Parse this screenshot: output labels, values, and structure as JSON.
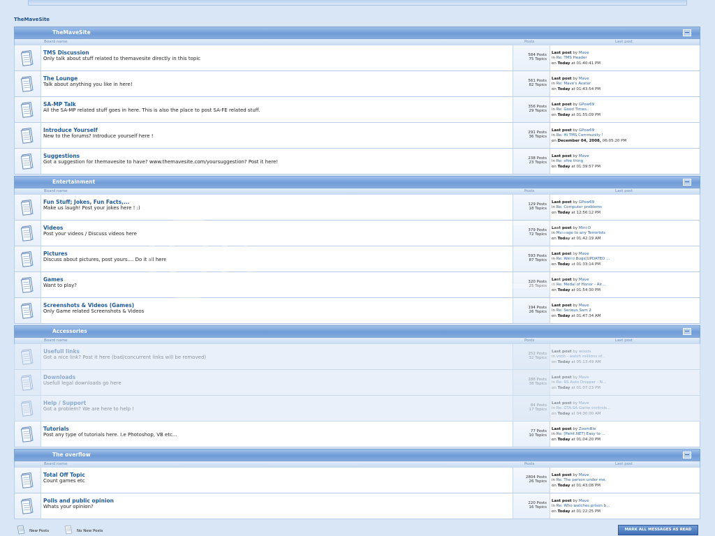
{
  "site": {
    "name": "TheMaveSite"
  },
  "columns": {
    "board_name": "Board name",
    "posts": "Posts",
    "last_post": "Last post"
  },
  "labels": {
    "last_post": "Last post",
    "by": "by",
    "in": "in",
    "on": "on"
  },
  "categories": [
    {
      "title": "TheMaveSite",
      "boards": [
        {
          "name": "TMS Discussion",
          "desc": "Only talk about stuff related to themavesite directly in this topic",
          "posts": "584 Posts",
          "topics": "75 Topics",
          "last_user": "Mave",
          "last_topic": "Re: TMS Header",
          "last_date": "Today",
          "last_time": "at 01:40:41 PM",
          "faded": false
        },
        {
          "name": "The Lounge",
          "desc": "Talk about anything you like in here!",
          "posts": "561 Posts",
          "topics": "82 Topics",
          "last_user": "Mave",
          "last_topic": "Re: Mave's Avatar",
          "last_date": "Today",
          "last_time": "at 01:43:54 PM",
          "faded": false
        },
        {
          "name": "SA-MP Talk",
          "desc": "All the SA-MP related stuff goes in here. This is also the place to post SA-FE related stuff.",
          "posts": "356 Posts",
          "topics": "29 Topics",
          "last_user": "GPow69",
          "last_topic": "Re: Good Times..",
          "last_date": "Today",
          "last_time": "at 01:55:09 PM",
          "faded": false
        },
        {
          "name": "Introduce Yourself",
          "desc": "New to the forums? Introduce yourself here !",
          "posts": "291 Posts",
          "topics": "36 Topics",
          "last_user": "GPow69",
          "last_topic": "Re: Hi TMS Community !",
          "last_date": "December 04, 2008,",
          "last_time": "06:05:20 PM",
          "faded": false
        },
        {
          "name": "Suggestions",
          "desc": "Got a suggestion for themavesite to have? www.themavesite.com/yoursuggestion? Post it here!",
          "posts": "238 Posts",
          "topics": "23 Topics",
          "last_user": "Mave",
          "last_topic": "Re: sfire thing",
          "last_date": "Today",
          "last_time": "at 01:39:57 PM",
          "faded": false
        }
      ]
    },
    {
      "title": "Entertainment",
      "boards": [
        {
          "name": "Fun Stuff; Jokes, Fun Facts,...",
          "desc": "Make us laugh! Post your jokes here ! :)",
          "posts": "129 Posts",
          "topics": "18 Topics",
          "last_user": "GPow69",
          "last_topic": "Re: Computer problems",
          "last_date": "Today",
          "last_time": "at 12:56:12 PM",
          "faded": false
        },
        {
          "name": "Videos",
          "desc": "Post your videos / Discuss videos here",
          "posts": "379 Posts",
          "topics": "72 Topics",
          "last_user": "Mini-D",
          "last_topic": "Message to any Terrorists",
          "last_date": "Today",
          "last_time": "at 01:42:19 AM",
          "faded": false
        },
        {
          "name": "Pictures",
          "desc": "Discuss about pictures, post yours.... Do it all here",
          "posts": "593 Posts",
          "topics": "87 Topics",
          "last_user": "Mave",
          "last_topic": "Re: Weird Bugs[UPDATED ...",
          "last_date": "Today",
          "last_time": "at 01:33:14 PM",
          "faded": false
        },
        {
          "name": "Games",
          "desc": "Want to play?",
          "posts": "320 Posts",
          "topics": "25 Topics",
          "last_user": "Mave",
          "last_topic": "Re: Medal of Honor - Air...",
          "last_date": "Today",
          "last_time": "at 01:54:30 PM",
          "faded": false
        },
        {
          "name": "Screenshots & Videos (Games)",
          "desc": "Only Game related Screenshots & Videos",
          "posts": "194 Posts",
          "topics": "26 Topics",
          "last_user": "Mave",
          "last_topic": "Re: Serious Sam 2",
          "last_date": "Today",
          "last_time": "at 01:47:34 AM",
          "faded": false
        }
      ]
    },
    {
      "title": "Accessories",
      "boards": [
        {
          "name": "Usefull links",
          "desc": "Got a nice link? Post it here (bad/concurrent links will be removed)",
          "posts": "252 Posts",
          "topics": "32 Topics",
          "last_user": "woods",
          "last_topic": "vooh - watch millions of...",
          "last_date": "Today",
          "last_time": "at 05:13:49 AM",
          "faded": true
        },
        {
          "name": "Downloads",
          "desc": "Usefull legal downloads go here",
          "posts": "288 Posts",
          "topics": "38 Topics",
          "last_user": "Mave",
          "last_topic": "Re: RS Auto Dropper - N...",
          "last_date": "Today",
          "last_time": "at 01:07:23 PM",
          "faded": true
        },
        {
          "name": "Help / Support",
          "desc": "Got a problem? We are here to help !",
          "posts": "84 Posts",
          "topics": "17 Topics",
          "last_user": "Mave",
          "last_topic": "Re: GTA:SA Game controls...",
          "last_date": "Today",
          "last_time": "at 04:30:00 AM",
          "faded": true
        },
        {
          "name": "Tutorials",
          "desc": "Post any type of tutorials here. I.e Photoshop, VB etc...",
          "posts": "77 Posts",
          "topics": "10 Topics",
          "last_user": "ZoomBie",
          "last_topic": "Re: [Paint.NET] Easy to ...",
          "last_date": "Today",
          "last_time": "at 01:04:20 PM",
          "faded": false
        }
      ]
    },
    {
      "title": "The overflow",
      "boards": [
        {
          "name": "Total Off Topic",
          "desc": "Count games etc",
          "posts": "2804 Posts",
          "topics": "26 Topics",
          "last_user": "Mave",
          "last_topic": "Re: The person under me.",
          "last_date": "Today",
          "last_time": "at 01:43:08 PM",
          "faded": false
        },
        {
          "name": "Polls and public opinion",
          "desc": "Whats your opinion?",
          "posts": "220 Posts",
          "topics": "16 Topics",
          "last_user": "Mave",
          "last_topic": "Re: Who watches prison b...",
          "last_date": "Today",
          "last_time": "at 01:22:25 PM",
          "faded": false
        }
      ]
    }
  ],
  "legend": {
    "new_posts": "New Posts",
    "no_new_posts": "No New Posts"
  },
  "mark_read_label": "MARK ALL MESSAGES AS READ"
}
